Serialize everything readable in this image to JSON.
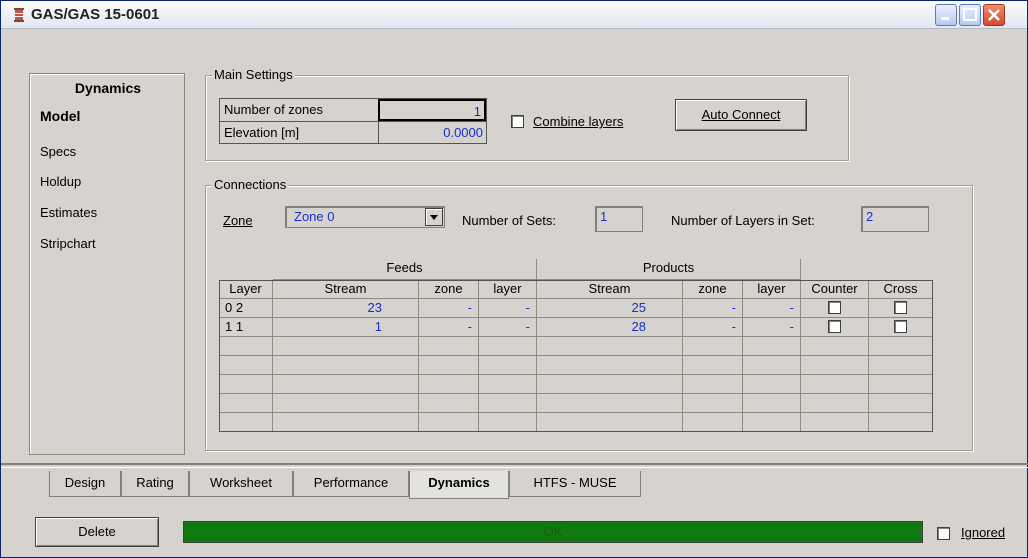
{
  "window": {
    "title": "GAS/GAS 15-0601"
  },
  "nav": {
    "title": "Dynamics",
    "items": [
      {
        "label": "Model",
        "active": true
      },
      {
        "label": "Specs",
        "active": false
      },
      {
        "label": "Holdup",
        "active": false
      },
      {
        "label": "Estimates",
        "active": false
      },
      {
        "label": "Stripchart",
        "active": false
      }
    ]
  },
  "main_settings": {
    "legend": "Main Settings",
    "number_of_zones_label": "Number of zones",
    "number_of_zones_value": "1",
    "elevation_label": "Elevation [m]",
    "elevation_value": "0.0000",
    "combine_layers_label": "Combine layers",
    "auto_connect_label": "Auto Connect"
  },
  "connections": {
    "legend": "Connections",
    "zone_label": "Zone",
    "zone_value": "Zone 0",
    "sets_label": "Number of Sets:",
    "sets_value": "1",
    "layers_label": "Number of Layers in Set:",
    "layers_value": "2",
    "group_headers": {
      "feeds": "Feeds",
      "products": "Products"
    },
    "columns": [
      "Layer",
      "Stream",
      "zone",
      "layer",
      "Stream",
      "zone",
      "layer",
      "Counter",
      "Cross"
    ],
    "rows": [
      {
        "layer": "0 2",
        "feed_stream": "23",
        "feed_zone": "-",
        "feed_layer": "-",
        "prod_stream": "25",
        "prod_zone": "-",
        "prod_layer": "-"
      },
      {
        "layer": "1 1",
        "feed_stream": "1",
        "feed_zone": "-",
        "feed_layer": "-",
        "prod_stream": "28",
        "prod_zone": "-",
        "prod_layer": "-"
      }
    ]
  },
  "tabs": [
    {
      "label": "Design",
      "active": false
    },
    {
      "label": "Rating",
      "active": false
    },
    {
      "label": "Worksheet",
      "active": false
    },
    {
      "label": "Performance",
      "active": false
    },
    {
      "label": "Dynamics",
      "active": true
    },
    {
      "label": "HTFS - MUSE",
      "active": false
    }
  ],
  "footer": {
    "delete_label": "Delete",
    "status_text": "OK",
    "ignored_label": "Ignored"
  },
  "colors": {
    "status_ok": "#0f7a0f",
    "value_blue": "#1a2ec8"
  }
}
